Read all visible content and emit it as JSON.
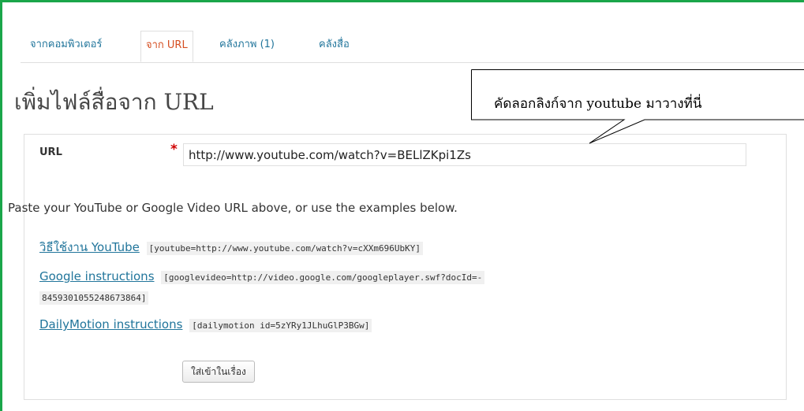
{
  "tabs": [
    {
      "label": "จากคอมพิวเตอร์"
    },
    {
      "label": "จาก URL",
      "active": true
    },
    {
      "label": "คลังภาพ (1)"
    },
    {
      "label": "คลังสื่อ"
    }
  ],
  "page_title": "เพิ่มไฟล์สื่อจาก URL",
  "callout": {
    "text": "คัดลอกลิงก์จาก youtube มาวางที่นี่"
  },
  "form": {
    "url_label": "URL",
    "required_mark": "*",
    "url_value": "http://www.youtube.com/watch?v=BELlZKpi1Zs"
  },
  "help_text": "Paste your YouTube or Google Video URL above, or use the examples below.",
  "examples": [
    {
      "link": "วิธีใช้งาน YouTube",
      "code": "[youtube=http://www.youtube.com/watch?v=cXXm696UbKY]"
    },
    {
      "link": "Google instructions",
      "code": "[googlevideo=http://video.google.com/googleplayer.swf?docId=-",
      "code_cont": "8459301055248673864]"
    },
    {
      "link": "DailyMotion instructions",
      "code": "[dailymotion id=5zYRy1JLhuGlP3BGw]"
    }
  ],
  "insert_button": "ใส่เข้าในเรื่อง",
  "colors": {
    "frame": "#1aa64a",
    "link": "#21759b",
    "active_tab": "#d54e21",
    "required": "#d00000"
  }
}
